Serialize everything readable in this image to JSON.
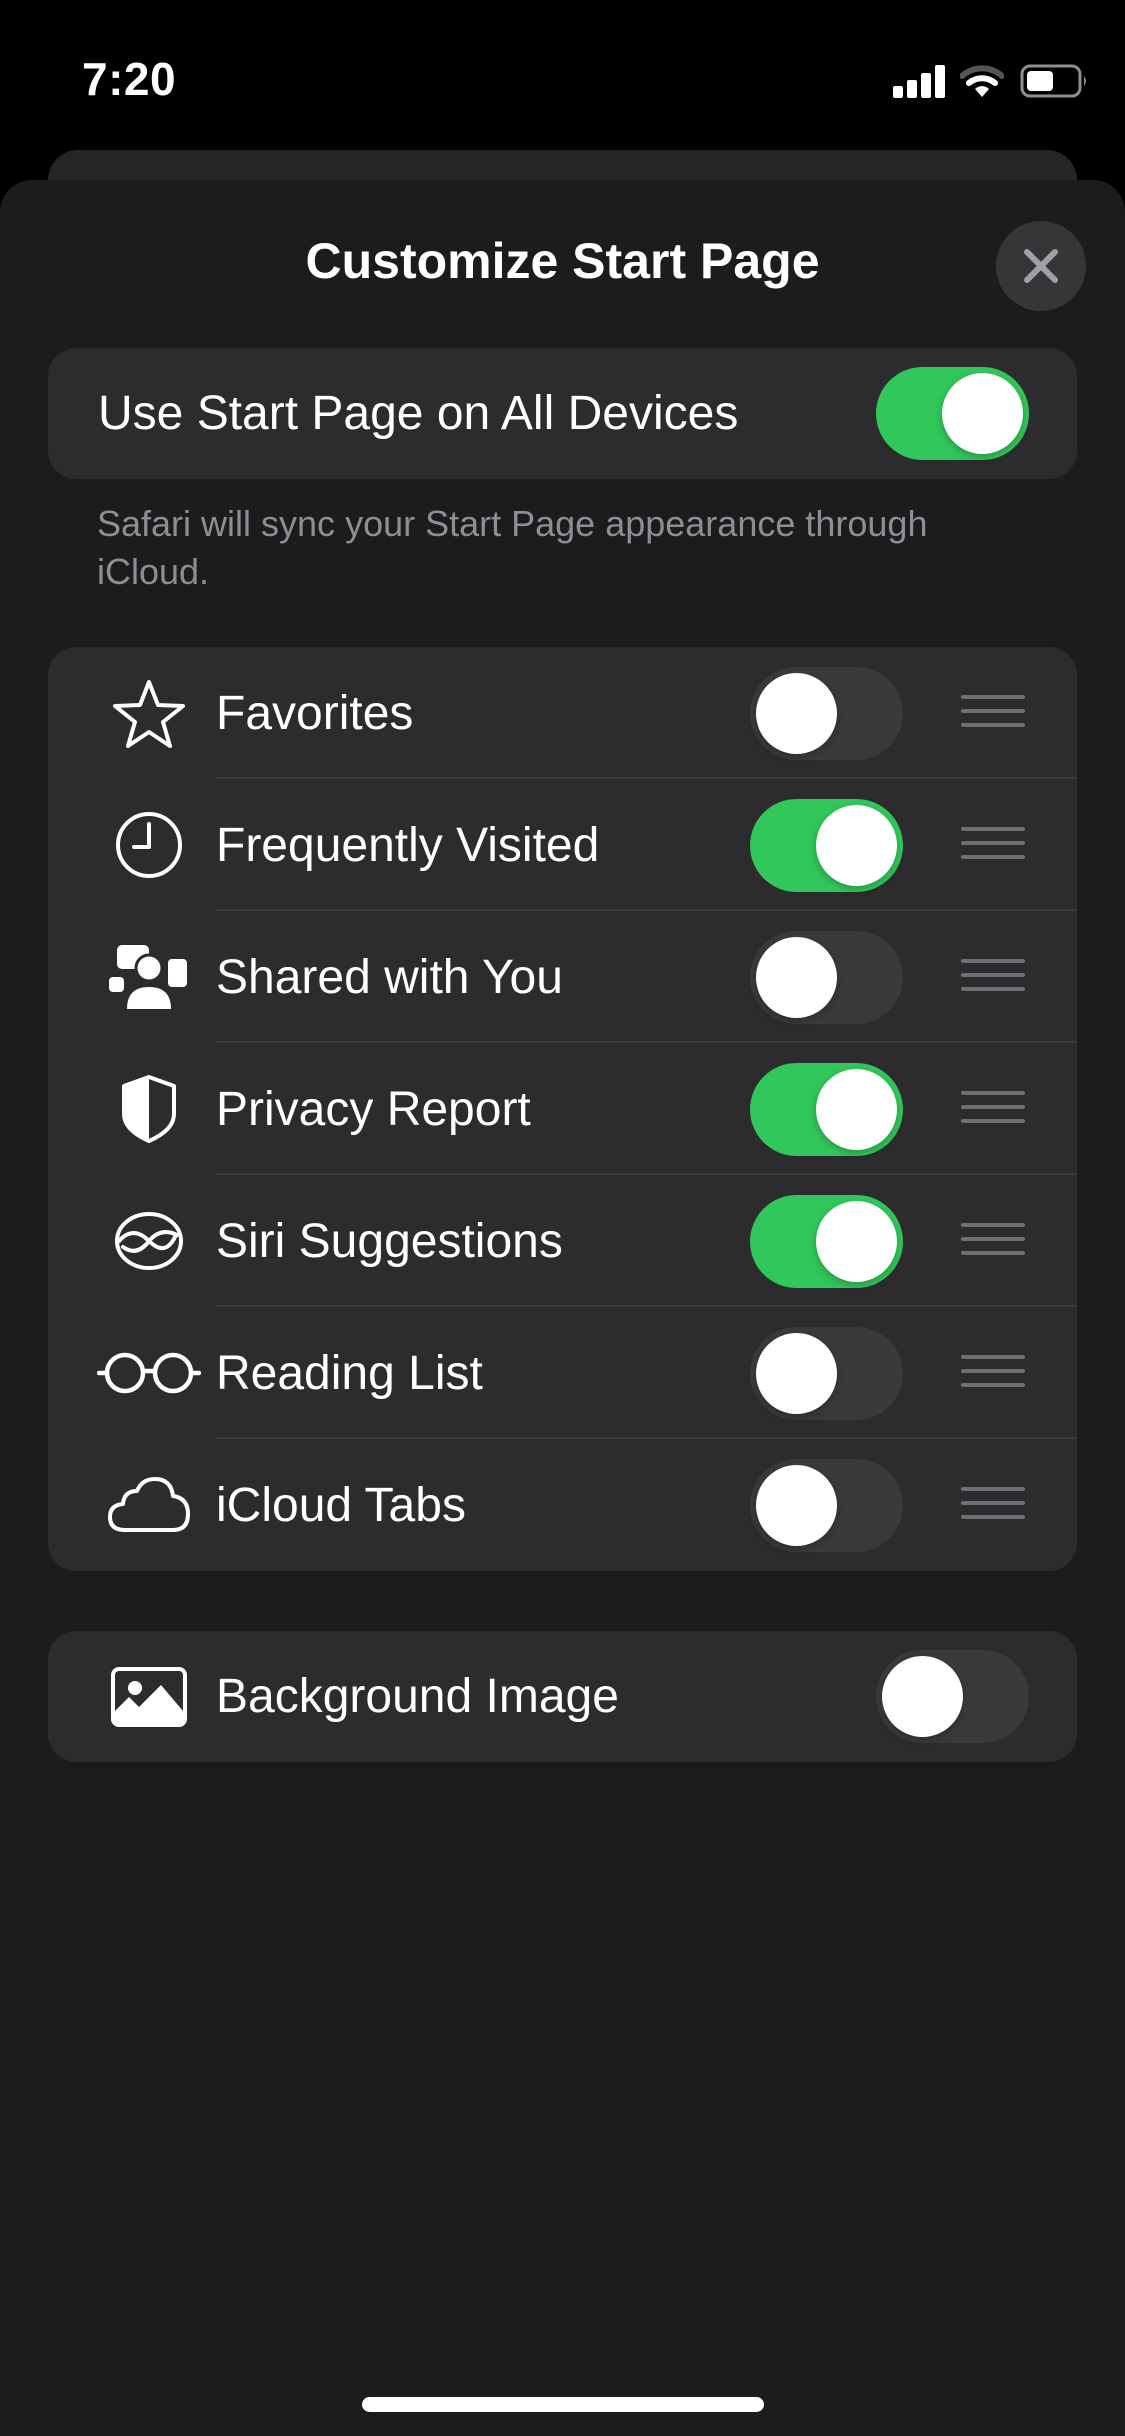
{
  "status_bar": {
    "time": "7:20",
    "signal_bars": 4,
    "wifi_strength_bars": "2 of 3",
    "battery_level_percent": 50,
    "icons": [
      "cellular-signal-icon",
      "wifi-icon",
      "battery-icon"
    ]
  },
  "sheet": {
    "title": "Customize Start Page",
    "close_icon": "xmark-icon"
  },
  "sync": {
    "label": "Use Start Page on All Devices",
    "enabled": true,
    "footer": "Safari will sync your Start Page appearance through iCloud."
  },
  "sections": [
    {
      "label": "Favorites",
      "icon": "star-icon",
      "enabled": false
    },
    {
      "label": "Frequently Visited",
      "icon": "clock-icon",
      "enabled": true
    },
    {
      "label": "Shared with You",
      "icon": "shared-with-you-icon",
      "enabled": false
    },
    {
      "label": "Privacy Report",
      "icon": "shield-icon",
      "enabled": true
    },
    {
      "label": "Siri Suggestions",
      "icon": "siri-icon",
      "enabled": true
    },
    {
      "label": "Reading List",
      "icon": "glasses-icon",
      "enabled": false
    },
    {
      "label": "iCloud Tabs",
      "icon": "cloud-icon",
      "enabled": false
    }
  ],
  "background_image": {
    "label": "Background Image",
    "icon": "photo-icon",
    "enabled": false
  },
  "colors": {
    "toggle_on": "#32c75a",
    "toggle_off": "#3a3a3d",
    "sheet_bg": "#1c1c1e",
    "card_bg": "#2c2c2e",
    "secondary_text": "#8e8e93"
  }
}
